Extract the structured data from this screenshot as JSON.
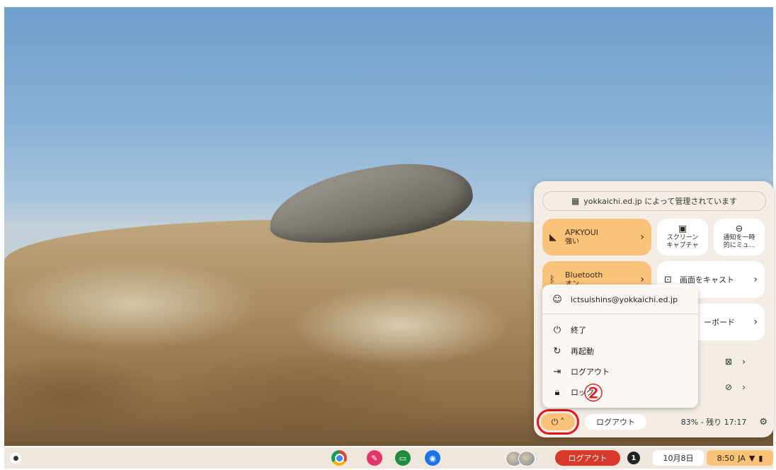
{
  "quick_settings": {
    "managed_text": "yokkaichi.ed.jp によって管理されています",
    "wifi": {
      "name": "APKYOUI",
      "status": "強い"
    },
    "screen_capture_line1": "スクリーン",
    "screen_capture_line2": "キャプチャ",
    "dnd_line1": "通知を一時",
    "dnd_line2": "的にミュ...",
    "bluetooth": {
      "name": "Bluetooth",
      "status": "オン"
    },
    "cast_label": "画面をキャスト",
    "keyboard_label": "ーボード",
    "logout_label": "ログアウト",
    "battery_text": "83% - 残り 17:17"
  },
  "power_menu": {
    "account": "ictsuishins@yokkaichi.ed.jp",
    "shutdown": "終了",
    "restart": "再起動",
    "signout": "ログアウト",
    "lock": "ロック"
  },
  "annotation": {
    "step": "②"
  },
  "shelf": {
    "logout_label": "ログアウト",
    "notification_count": "1",
    "date": "10月8日",
    "time": "8:50",
    "ime": "JA"
  },
  "icons": {
    "power": "power-icon",
    "wifi": "wifi-icon",
    "bluetooth": "bluetooth-icon",
    "settings": "gear-icon"
  },
  "colors": {
    "accent_tile": "#fbc27a",
    "highlight_box": "#e5131b",
    "shelf_logout": "#d9392b"
  }
}
